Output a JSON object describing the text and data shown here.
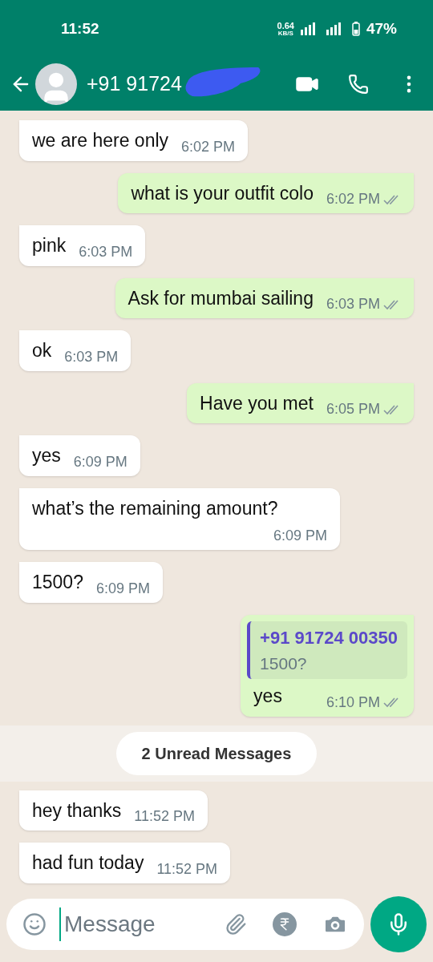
{
  "status_bar": {
    "time": "11:52",
    "speed": "0.64",
    "speed_unit": "KB/S",
    "battery": "47%"
  },
  "header": {
    "title": "+91 91724"
  },
  "messages": [
    {
      "kind": "incoming",
      "text": "we are here only",
      "time": "6:02 PM"
    },
    {
      "kind": "outgoing",
      "text": "what is your outfit colo",
      "time": "6:02 PM",
      "read": false
    },
    {
      "kind": "incoming",
      "text": "pink",
      "time": "6:03 PM"
    },
    {
      "kind": "outgoing",
      "text": "Ask for mumbai sailing",
      "time": "6:03 PM",
      "read": false
    },
    {
      "kind": "incoming",
      "text": "ok",
      "time": "6:03 PM"
    },
    {
      "kind": "outgoing",
      "text": "Have you met",
      "time": "6:05 PM",
      "read": false
    },
    {
      "kind": "incoming",
      "text": "yes",
      "time": "6:09 PM"
    },
    {
      "kind": "incoming",
      "text": "what’s the remaining amount?",
      "time": "6:09 PM"
    },
    {
      "kind": "incoming",
      "text": "1500?",
      "time": "6:09 PM"
    },
    {
      "kind": "outgoing",
      "text": "yes",
      "time": "6:10 PM",
      "read": false,
      "quote": {
        "author": "+91 91724 00350",
        "text": "1500?"
      }
    },
    {
      "kind": "divider",
      "text": "2 Unread Messages"
    },
    {
      "kind": "incoming",
      "text": "hey thanks",
      "time": "11:52 PM"
    },
    {
      "kind": "incoming",
      "text": "had fun today",
      "time": "11:52 PM"
    }
  ],
  "composer": {
    "placeholder": "Message"
  }
}
